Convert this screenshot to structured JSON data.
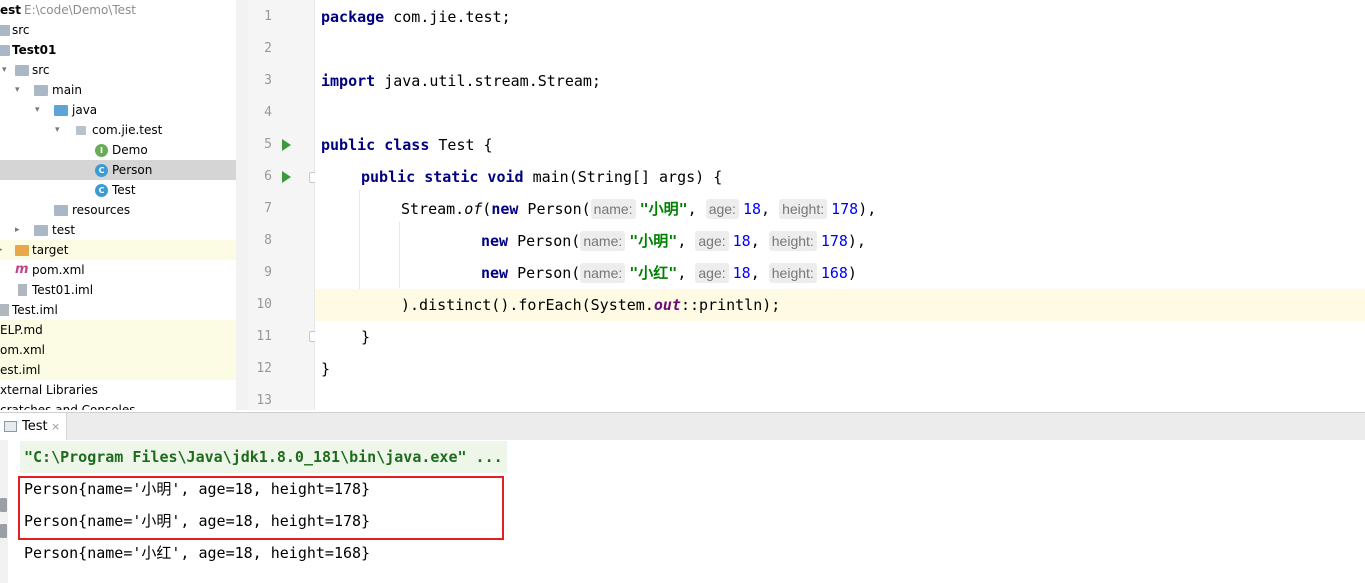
{
  "project_tree": {
    "root_label": "est",
    "root_path": "E:\\code\\Demo\\Test",
    "rows": [
      {
        "label": "src",
        "icon": "folder-icon"
      },
      {
        "label": "Test01",
        "icon": "module-folder-icon"
      },
      {
        "label": "src",
        "icon": "folder-icon"
      },
      {
        "label": "main",
        "icon": "folder-icon"
      },
      {
        "label": "java",
        "icon": "source-folder-icon"
      },
      {
        "label": "com.jie.test",
        "icon": "package-icon"
      },
      {
        "label": "Demo",
        "icon": "interface-icon"
      },
      {
        "label": "Person",
        "icon": "class-icon"
      },
      {
        "label": "Test",
        "icon": "class-icon"
      },
      {
        "label": "resources",
        "icon": "resources-folder-icon"
      },
      {
        "label": "test",
        "icon": "folder-icon"
      },
      {
        "label": "target",
        "icon": "excluded-folder-icon"
      },
      {
        "label": "pom.xml",
        "icon": "maven-icon"
      },
      {
        "label": "Test01.iml",
        "icon": "iml-file-icon"
      },
      {
        "label": "Test.iml",
        "icon": "iml-file-icon"
      },
      {
        "label": "ELP.md",
        "icon": "file-icon"
      },
      {
        "label": "om.xml",
        "icon": "file-icon"
      },
      {
        "label": "est.iml",
        "icon": "file-icon"
      },
      {
        "label": "xternal Libraries",
        "icon": "library-icon"
      },
      {
        "label": "cratches and Consoles",
        "icon": "scratch-icon"
      }
    ]
  },
  "editor": {
    "line_numbers": [
      "1",
      "2",
      "3",
      "4",
      "5",
      "6",
      "7",
      "8",
      "9",
      "10",
      "11",
      "12",
      "13"
    ],
    "current_line": 10,
    "code": {
      "l1_kw": "package",
      "l1_rest": " com.jie.test;",
      "l3_kw": "import",
      "l3_rest": " java.util.stream.Stream;",
      "l5_kw": "public class",
      "l5_rest": " Test {",
      "l6_kw1": "public static void",
      "l6_rest": " main(String[] args) {",
      "stream": "Stream.",
      "of": "of",
      "open_paren": "(",
      "new_kw": "new",
      "person_open": " Person(",
      "hint_name": "name:",
      "hint_age": "age:",
      "hint_height": "height:",
      "val_xiaoming": "\"小明\"",
      "val_xiaohong": "\"小红\"",
      "comma_sp": ",",
      "age_val": "18",
      "height_178": "178",
      "height_168": "168",
      "close1": "),",
      "close2": ")",
      "l10_a": ").distinct().forEach(System.",
      "l10_out": "out",
      "l10_b": "::println);",
      "l11": "}",
      "l12": "}"
    }
  },
  "run_panel": {
    "tab_label": "Test",
    "tab_close": "×",
    "command_line": "\"C:\\Program Files\\Java\\jdk1.8.0_181\\bin\\java.exe\" ...",
    "output": [
      "Person{name='小明', age=18, height=178}",
      "Person{name='小明', age=18, height=178}",
      "Person{name='小红', age=18, height=168}"
    ],
    "highlight_color": "#e02020"
  }
}
